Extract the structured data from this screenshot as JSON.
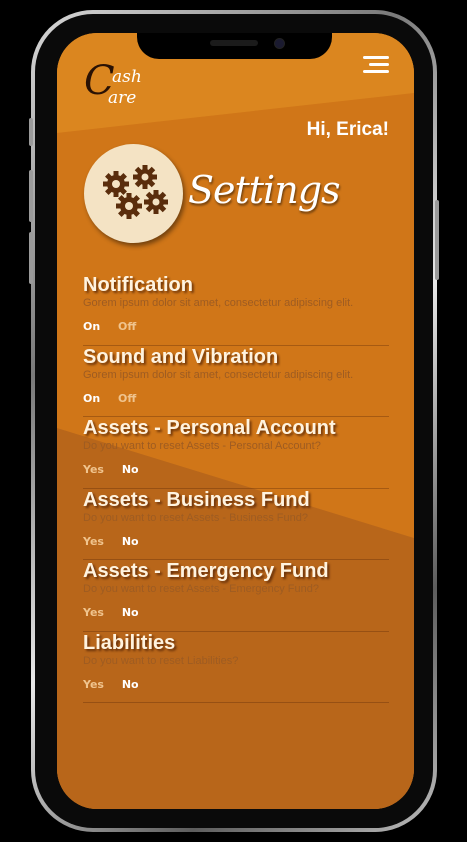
{
  "app": {
    "logo_text_top": "ash",
    "logo_text_bottom": "are",
    "logo_letter_c1": "C",
    "logo_letter_c2": "C"
  },
  "header": {
    "greeting": "Hi, Erica!",
    "title": "Settings"
  },
  "settings": [
    {
      "title": "Notification",
      "desc": "Gorem ipsum dolor sit amet, consectetur adipiscing elit.",
      "opt1": "On",
      "opt2": "Off",
      "selected": "On"
    },
    {
      "title": "Sound and Vibration",
      "desc": "Gorem ipsum dolor sit amet, consectetur adipiscing elit.",
      "opt1": "On",
      "opt2": "Off",
      "selected": "On"
    },
    {
      "title": "Assets - Personal Account",
      "desc": "Do you want to reset Assets - Personal Account?",
      "opt1": "Yes",
      "opt2": "No",
      "selected": "No"
    },
    {
      "title": "Assets - Business Fund",
      "desc": "Do you want to reset Assets - Business Fund?",
      "opt1": "Yes",
      "opt2": "No",
      "selected": "No"
    },
    {
      "title": "Assets - Emergency Fund",
      "desc": "Do you want to reset Assets - Emergency Fund?",
      "opt1": "Yes",
      "opt2": "No",
      "selected": "No"
    },
    {
      "title": "Liabilities",
      "desc": "Do you want to reset Liabilities?",
      "opt1": "Yes",
      "opt2": "No",
      "selected": "No"
    }
  ],
  "icons": {
    "menu": "hamburger-menu-icon",
    "settings": "gears-icon"
  },
  "colors": {
    "background": "#d7801f",
    "background_dark": "#b5651a",
    "badge": "#f4e3c4",
    "gear": "#5a2d0c"
  }
}
